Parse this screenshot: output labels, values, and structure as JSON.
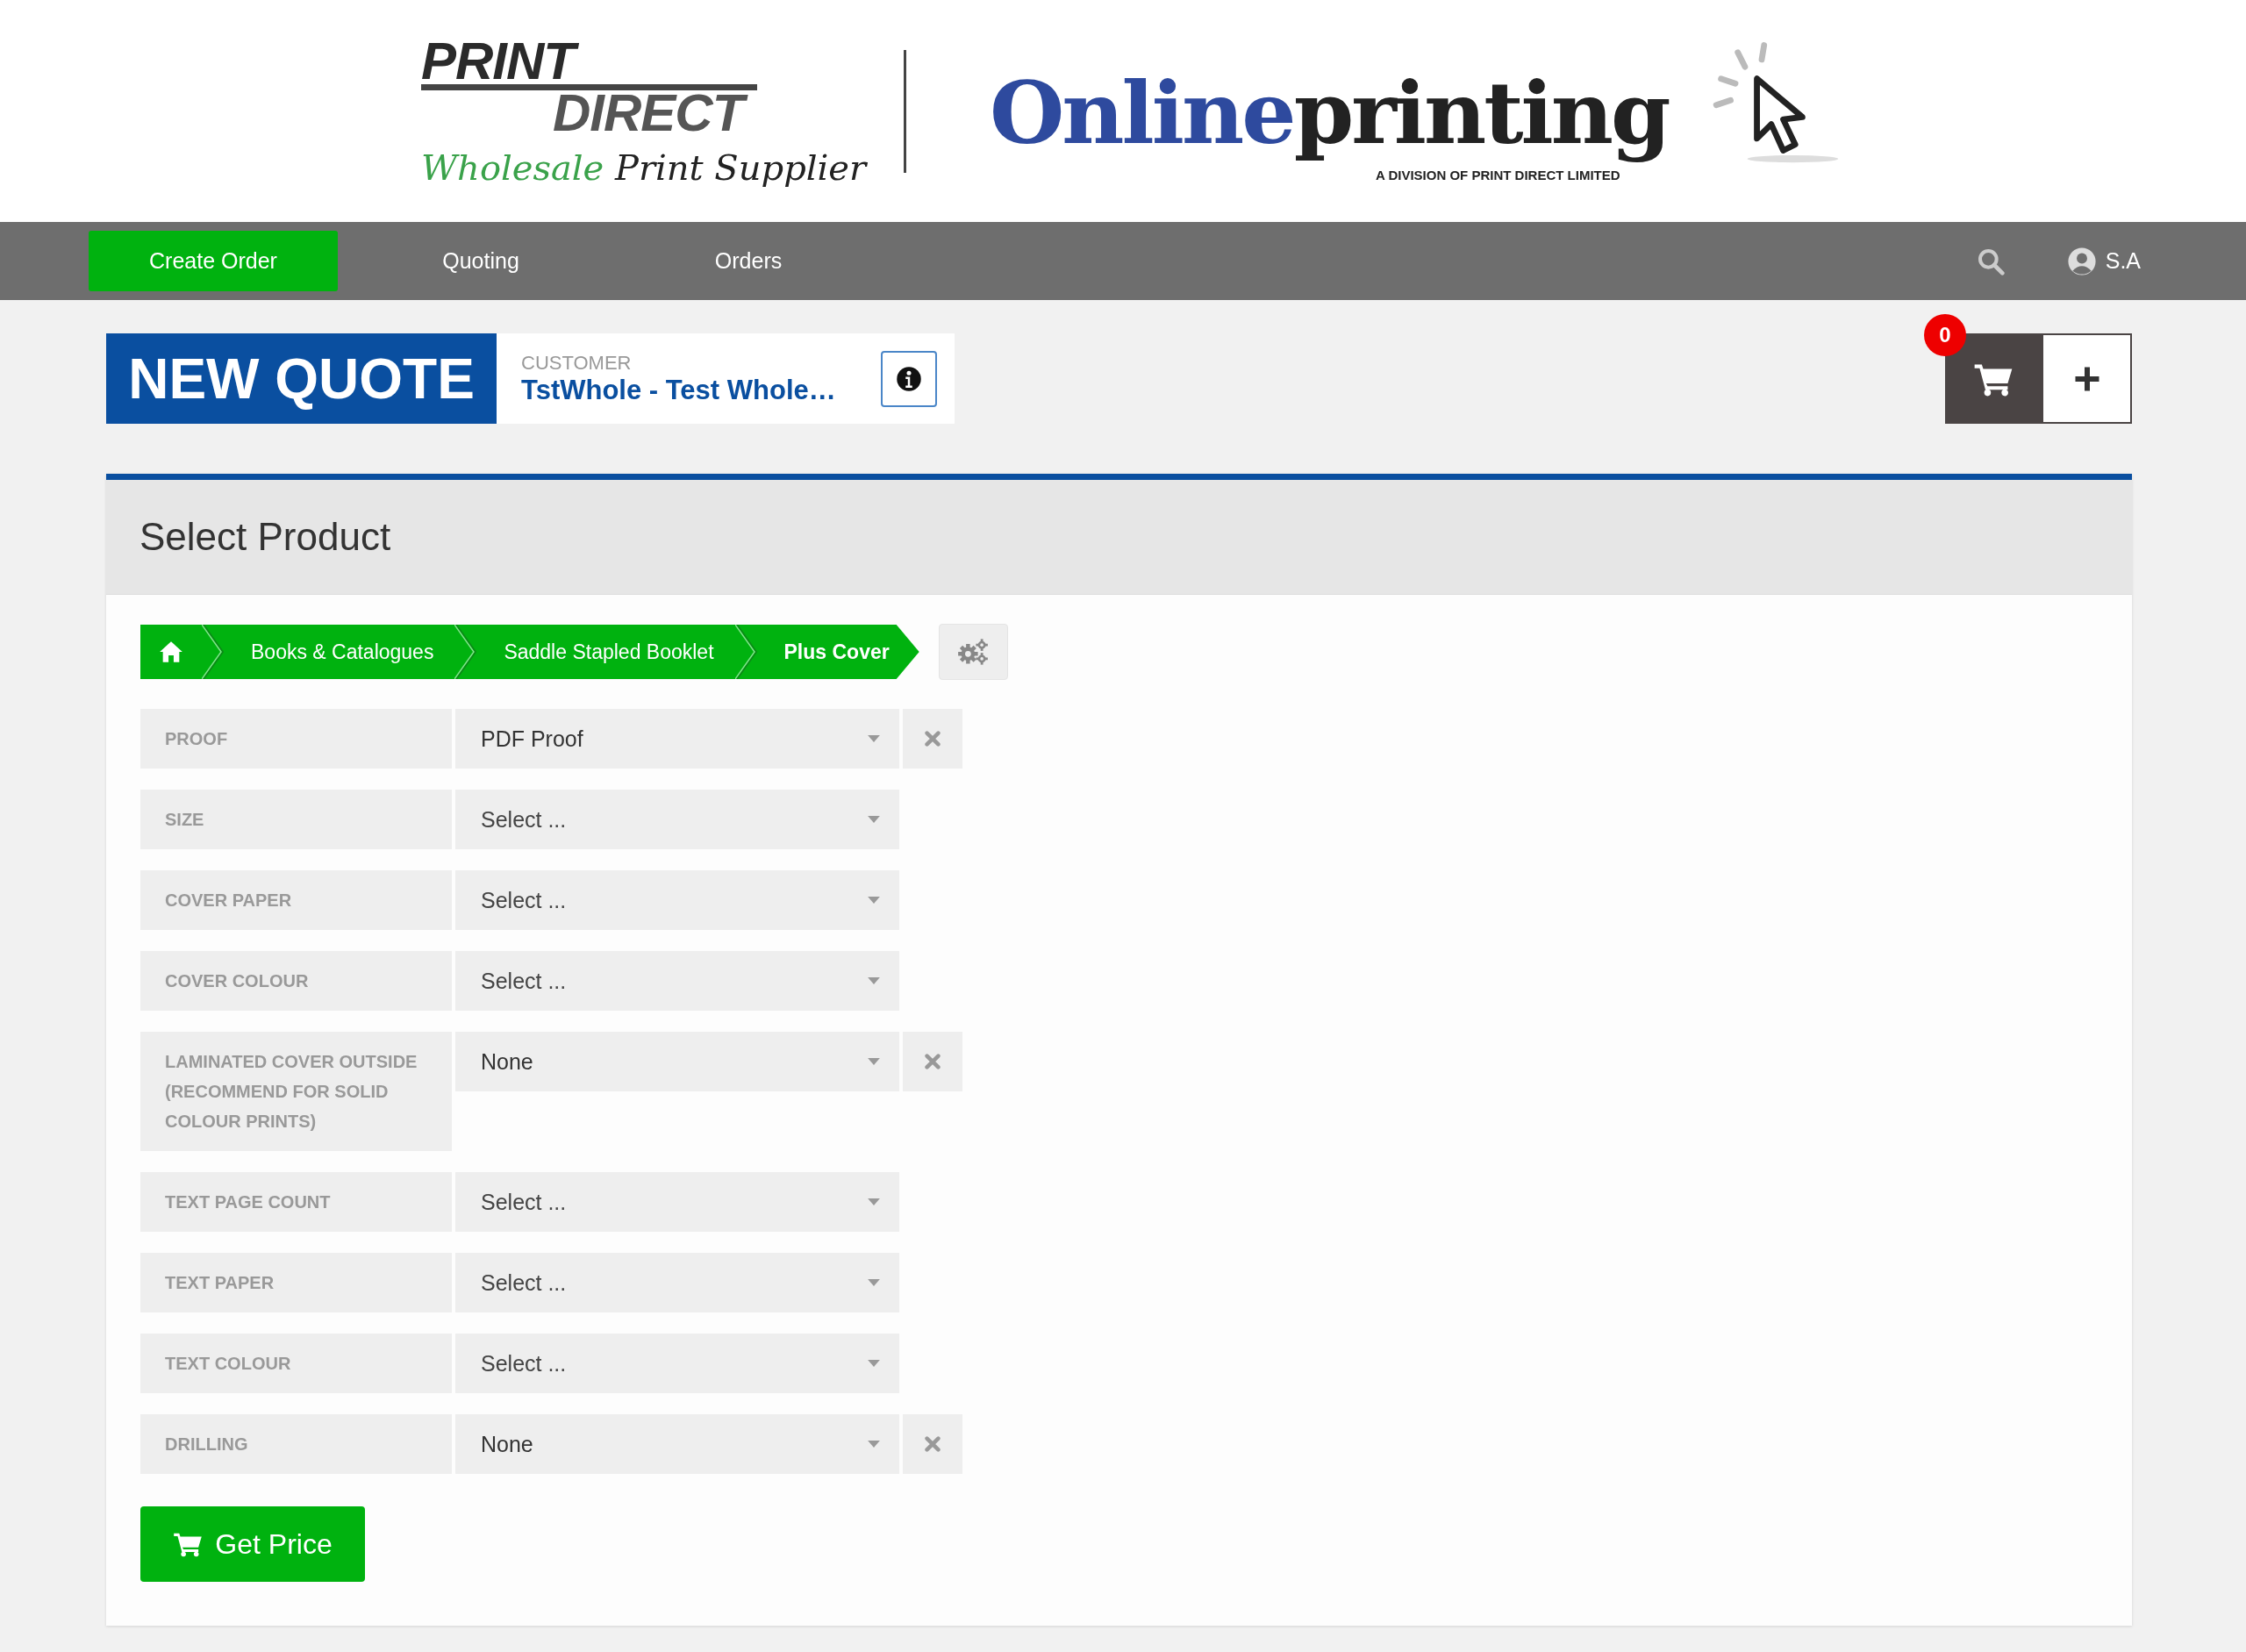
{
  "header": {
    "logo_left": {
      "line_1": "PRINT",
      "line_2": "DIRECT",
      "tagline_1": "Wholesale",
      "tagline_2": "Print Supplier"
    },
    "logo_right": {
      "part_1": "Online",
      "part_2": "printing",
      "subtitle": "A DIVISION OF PRINT DIRECT LIMITED"
    }
  },
  "nav": {
    "items": [
      {
        "label": "Create Order",
        "selected": true
      },
      {
        "label": "Quoting",
        "selected": false
      },
      {
        "label": "Orders",
        "selected": false
      }
    ],
    "user": "S.A"
  },
  "quote": {
    "title": "NEW QUOTE",
    "customer_label": "CUSTOMER",
    "customer": "TstWhole - Test Whole…",
    "cart_count": "0"
  },
  "panel": {
    "title": "Select Product",
    "breadcrumb": [
      {
        "kind": "home"
      },
      {
        "kind": "link",
        "label": "Books & Catalogues",
        "current": false
      },
      {
        "kind": "link",
        "label": "Saddle Stapled Booklet",
        "current": false
      },
      {
        "kind": "link",
        "label": "Plus Cover",
        "current": true
      }
    ],
    "options": [
      {
        "label": "PROOF",
        "value": "PDF Proof",
        "clearable": true
      },
      {
        "label": "SIZE",
        "placeholder": "Select ...",
        "clearable": false
      },
      {
        "label": "COVER PAPER",
        "placeholder": "Select ...",
        "clearable": false
      },
      {
        "label": "COVER COLOUR",
        "placeholder": "Select ...",
        "clearable": false
      },
      {
        "label": "LAMINATED COVER OUTSIDE (RECOMMEND FOR SOLID COLOUR PRINTS)",
        "value": "None",
        "clearable": true
      },
      {
        "label": "TEXT PAGE COUNT",
        "placeholder": "Select ...",
        "clearable": false
      },
      {
        "label": "TEXT PAPER",
        "placeholder": "Select ...",
        "clearable": false
      },
      {
        "label": "TEXT COLOUR",
        "placeholder": "Select ...",
        "clearable": false
      },
      {
        "label": "DRILLING",
        "value": "None",
        "clearable": true
      }
    ],
    "button": "Get Price"
  }
}
